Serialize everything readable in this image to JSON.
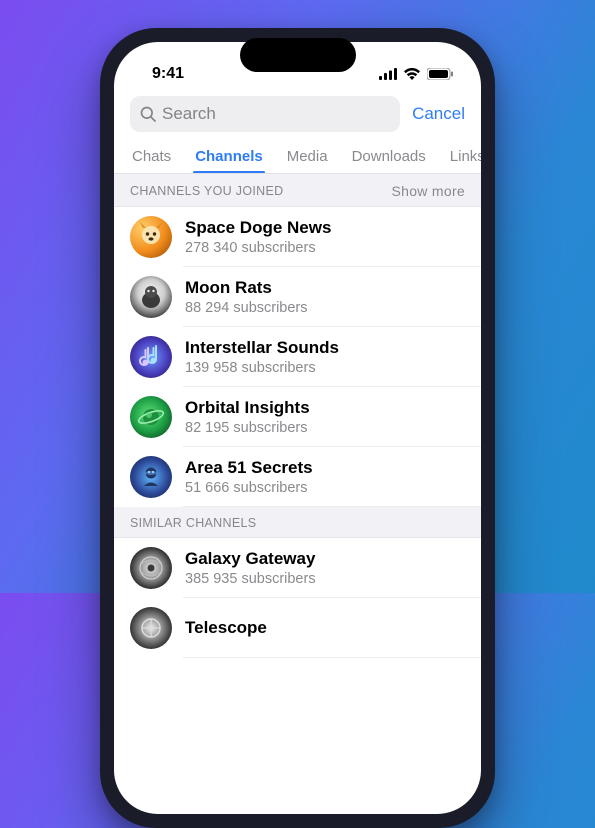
{
  "status": {
    "time": "9:41"
  },
  "search": {
    "placeholder": "Search",
    "cancel": "Cancel"
  },
  "tabs": [
    "Chats",
    "Channels",
    "Media",
    "Downloads",
    "Links"
  ],
  "active_tab": 1,
  "sections": [
    {
      "label": "CHANNELS YOU JOINED",
      "more": "Show more",
      "items": [
        {
          "name": "Space Doge News",
          "sub": "278 340 subscribers"
        },
        {
          "name": "Moon Rats",
          "sub": "88 294 subscribers"
        },
        {
          "name": "Interstellar Sounds",
          "sub": "139 958 subscribers"
        },
        {
          "name": "Orbital Insights",
          "sub": "82 195 subscribers"
        },
        {
          "name": "Area 51 Secrets",
          "sub": "51 666 subscribers"
        }
      ]
    },
    {
      "label": "SIMILAR CHANNELS",
      "items": [
        {
          "name": "Galaxy Gateway",
          "sub": "385 935 subscribers"
        },
        {
          "name": "Telescope",
          "sub": ""
        }
      ]
    }
  ],
  "colors": {
    "accent": "#2f7cf6"
  }
}
